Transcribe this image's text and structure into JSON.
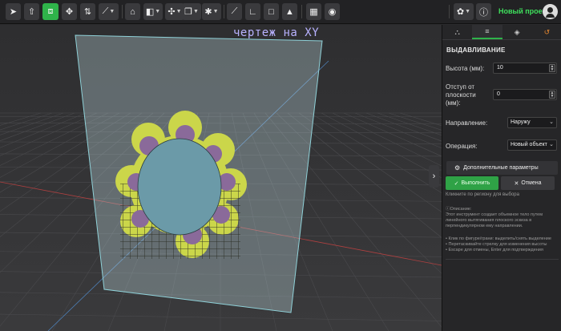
{
  "toolbar": {
    "project_name": "Новый проект",
    "tools": [
      {
        "icon": "cursor-icon"
      },
      {
        "icon": "export-icon"
      },
      {
        "icon": "extrude-icon",
        "active": true
      },
      {
        "icon": "move-axis-icon"
      },
      {
        "icon": "revolve-icon"
      },
      {
        "icon": "line-tool-icon",
        "dropdown": true
      },
      {
        "icon": "fillet-icon"
      },
      {
        "icon": "boolean-icon",
        "dropdown": true
      },
      {
        "icon": "transform-icon",
        "dropdown": true
      },
      {
        "icon": "duplicate-icon",
        "dropdown": true
      },
      {
        "icon": "pattern-icon",
        "dropdown": true
      },
      {
        "icon": "measure-icon"
      },
      {
        "icon": "angle-icon"
      },
      {
        "icon": "square-icon"
      },
      {
        "icon": "graduation-icon"
      },
      {
        "icon": "grid-icon"
      },
      {
        "icon": "snap-icon"
      }
    ],
    "right": [
      {
        "icon": "settings-icon",
        "dropdown": true
      },
      {
        "icon": "info-icon"
      }
    ]
  },
  "viewport": {
    "sketch_label": "чертеж на XY"
  },
  "panel": {
    "tabs": [
      {
        "icon": "tree-icon",
        "glyph": "⛬"
      },
      {
        "icon": "sliders-icon",
        "glyph": "≡",
        "active": true
      },
      {
        "icon": "layers-icon",
        "glyph": "◈"
      },
      {
        "icon": "history-icon",
        "glyph": "↺"
      }
    ],
    "title": "ВЫДАВЛИВАНИЕ",
    "height_label": "Высота (мм):",
    "height_value": "10",
    "offset_label_1": "Отступ от",
    "offset_label_2": "плоскости",
    "offset_label_3": "(мм):",
    "offset_value": "0",
    "direction_label": "Направление:",
    "direction_value": "Наружу",
    "operation_label": "Операция:",
    "operation_value": "Новый объект",
    "advanced_button": "Дополнительные параметры",
    "run_button": "Выполнить",
    "cancel_button": "Отмена",
    "hint": "Кликните по региону для выбора",
    "description_title": "Описание:",
    "description": "Этот инструмент создает объемное тело путем линейного вытягивания плоского эскиза в перпендикулярном ему направлении.",
    "tips": [
      "• Клик по фигуре/грани: выделить/снять выделение",
      "• Перетаскивайте стрелку для изменения высоты",
      "• Escape для отмены, Enter для подтверждения"
    ]
  },
  "colors": {
    "accent": "#2fb34a",
    "project_name": "#3ee05c",
    "sketch_label": "#b8b2ff",
    "shape_fill": "#cbd64a",
    "petal": "#8a6a9a",
    "center": "#6b9aa8"
  }
}
